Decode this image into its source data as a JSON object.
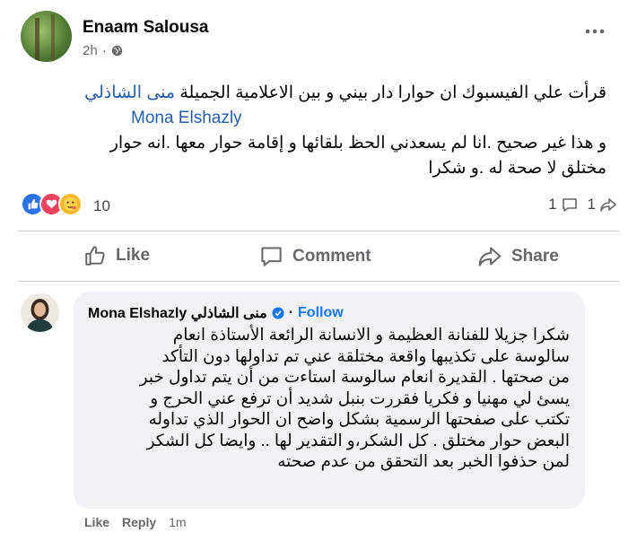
{
  "post": {
    "author": "Enaam Salousa",
    "time": "2h",
    "separator": "·",
    "text_line1": "قرأت علي الفيسبوك ان حوارا دار  بيني و بين الاعلامية الجميلة ",
    "mention_ar": "منى الشاذلي",
    "mention_en": "Mona Elshazly",
    "text_line3": "و هذا غير صحيح .انا لم يسعدني الحظ بلقائها  و إقامة حوار معها .انه حوار",
    "text_line4": "مختلق لا صحة له .و شكرا"
  },
  "reactions": {
    "count": "10",
    "comments_count": "1",
    "shares_count": "1"
  },
  "actions": {
    "like": "Like",
    "comment": "Comment",
    "share": "Share"
  },
  "comment": {
    "author": "Mona Elshazly منى الشاذلي",
    "follow_sep": "·",
    "follow": "Follow",
    "lines": [
      "شكرا جزيلا للفنانة العظيمة و الانسانة الرائعة الأستاذة انعام",
      "سالوسة على تكذيبها واقعة مختلقة عني تم تداولها دون التأكد",
      "من صحتها . القديرة انعام سالوسة استاءت من أن يتم تداول خبر",
      "يسئ لي مهنيا و فكريا فقررت بنبل شديد أن ترفع عني الحرج و",
      "تكتب على صفحتها الرسمية بشكل واضح ان الحوار الذي تداوله",
      "البعض حوار مختلق . كل الشكر،و التقدير لها .. وايضا كل الشكر",
      "لمن حذفوا الخبر بعد التحقق من عدم صحته"
    ],
    "like": "Like",
    "reply": "Reply",
    "time": "1m"
  },
  "colors": {
    "link": "#2a5ca8",
    "follow": "#1877f2",
    "secondary_text": "#65676b",
    "bubble": "#f0f2f5"
  }
}
